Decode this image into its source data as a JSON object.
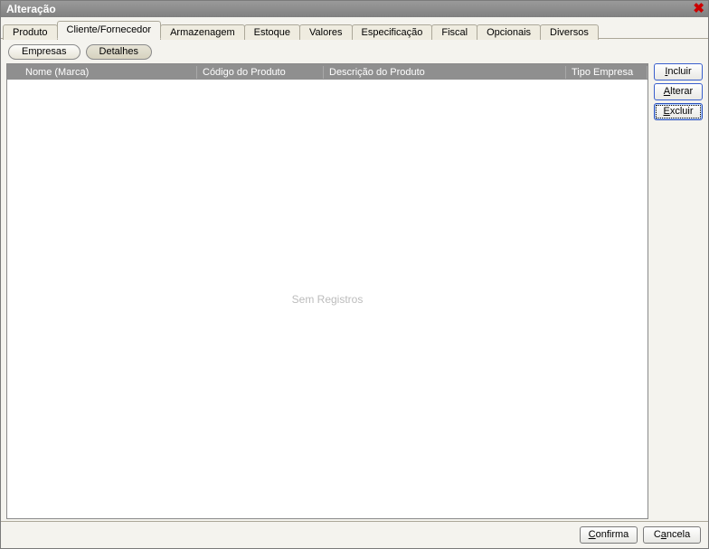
{
  "window": {
    "title": "Alteração"
  },
  "tabs": [
    {
      "label": "Produto"
    },
    {
      "label": "Cliente/Fornecedor"
    },
    {
      "label": "Armazenagem"
    },
    {
      "label": "Estoque"
    },
    {
      "label": "Valores"
    },
    {
      "label": "Especificação"
    },
    {
      "label": "Fiscal"
    },
    {
      "label": "Opcionais"
    },
    {
      "label": "Diversos"
    }
  ],
  "active_tab_index": 1,
  "subtabs": [
    {
      "label": "Empresas"
    },
    {
      "label": "Detalhes"
    }
  ],
  "active_subtab_index": 1,
  "table": {
    "columns": {
      "nome": "Nome (Marca)",
      "codigo": "Código do Produto",
      "descricao": "Descrição do Produto",
      "tipo": "Tipo Empresa"
    },
    "rows": [],
    "empty_message": "Sem Registros"
  },
  "side_buttons": {
    "incluir": {
      "mnemonic": "I",
      "rest": "ncluir"
    },
    "alterar": {
      "mnemonic": "A",
      "rest": "lterar"
    },
    "excluir": {
      "mnemonic": "E",
      "rest": "xcluir"
    }
  },
  "footer_buttons": {
    "confirma": {
      "mnemonic": "C",
      "rest": "onfirma"
    },
    "cancela": {
      "mnemonic": "a",
      "prefix": "C",
      "rest": "ncela"
    }
  }
}
